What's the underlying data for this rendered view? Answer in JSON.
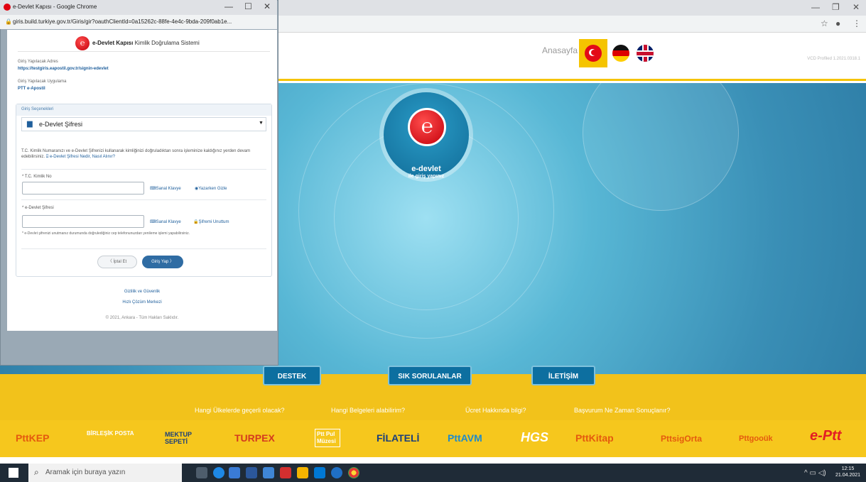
{
  "background": {
    "header": {
      "home_label": "Anasayfa",
      "version": "VCD Profiled 1.2021.0318.1"
    },
    "hero": {
      "title": "e-devlet",
      "subtitle": "ile giriş yapınız"
    },
    "band_buttons": [
      "DESTEK",
      "SIK SORULANLAR",
      "İLETİŞİM"
    ],
    "band_links": [
      "Hangi Ülkelerde geçerli olacak?",
      "Hangi Belgeleri alabilirim?",
      "Ücret Hakkında bilgi?",
      "Başvurum Ne Zaman Sonuçlanır?"
    ],
    "logos": [
      "PttKEP",
      "BİRLEŞİK POSTA",
      "MEKTUP SEPETİ",
      "TURPEX",
      "Ptt Pul Müzesi",
      "FİLATELİ",
      "PttAVM",
      "HGS",
      "PttKitap",
      "PttsigOrta",
      "Pttgooük",
      "e-Ptt"
    ]
  },
  "taskbar": {
    "search_placeholder": "Aramak için buraya yazın",
    "time": "12:15",
    "date": "21.04.2021"
  },
  "popup": {
    "window_title": "e-Devlet Kapısı - Google Chrome",
    "url": "giris.build.turkiye.gov.tr/Giris/gir?oauthClientId=0a15262c-88fe-4e4c-9bda-209f0ab1e...",
    "brand_bold": "e-Devlet Kapısı",
    "brand_rest": "Kimlik Doğrulama Sistemi",
    "target_label": "Giriş Yapılacak Adres",
    "target_value": "https://testgiris.eapostil.gov.tr/signin-edevlet",
    "app_label": "Giriş Yapılacak Uygulama",
    "app_value": "PTT e-Apostil",
    "options_header": "Giriş Seçenekleri",
    "selected_option": "e-Devlet Şifresi",
    "info_text": "T.C. Kimlik Numaranızı ve e-Devlet Şifrenizi kullanarak kimliğinizi doğruladıktan sonra işleminize kaldığınız yerden devam edebilirsiniz.",
    "info_link": "e-Devlet Şifresi Nedir, Nasıl Alınır?",
    "tc_label": "* T.C. Kimlik No",
    "tc_value": "",
    "virtual_keyboard": "Sanal Klavye",
    "hide_while_typing": "Yazarken Gizle",
    "password_label": "* e-Devlet Şifresi",
    "password_value": "",
    "forgot_password": "Şifremi Unuttum",
    "forgot_note": "* e-Devlet  şifrenizi unutmanız durumunda doğrulediğiniz cep telefonunuzdan yenileme işlemi yapabilirsiniz.",
    "cancel_label": "〈 İptal Et",
    "login_label": "Giriş Yap 〉",
    "privacy_link": "Gizlilik ve Güvenlik",
    "help_link": "Hızlı Çözüm Merkezi",
    "copyright": "© 2021, Ankara - Tüm Hakları Saklıdır."
  }
}
